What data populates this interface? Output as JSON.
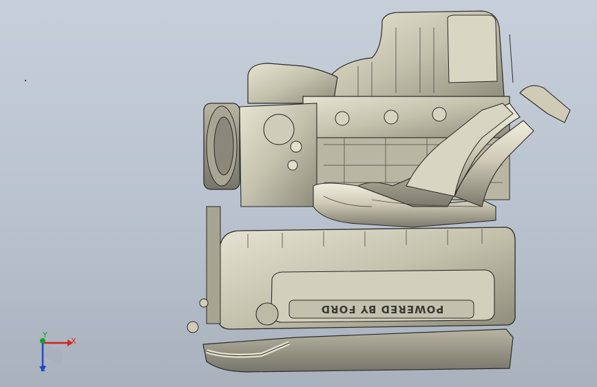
{
  "viewport": {
    "background_top": "#c6cfda",
    "background_bottom": "#a9b1bd"
  },
  "model": {
    "valve_cover_text": "POWERED BY FORD",
    "body_color": "#c9c6b2",
    "edge_color": "#2a2a26"
  },
  "triad": {
    "x_label": "X",
    "y_label": "Y",
    "z_label": "Z",
    "x_color": "#d8231f",
    "y_color": "#1e9a2a",
    "z_color": "#2146c9"
  }
}
